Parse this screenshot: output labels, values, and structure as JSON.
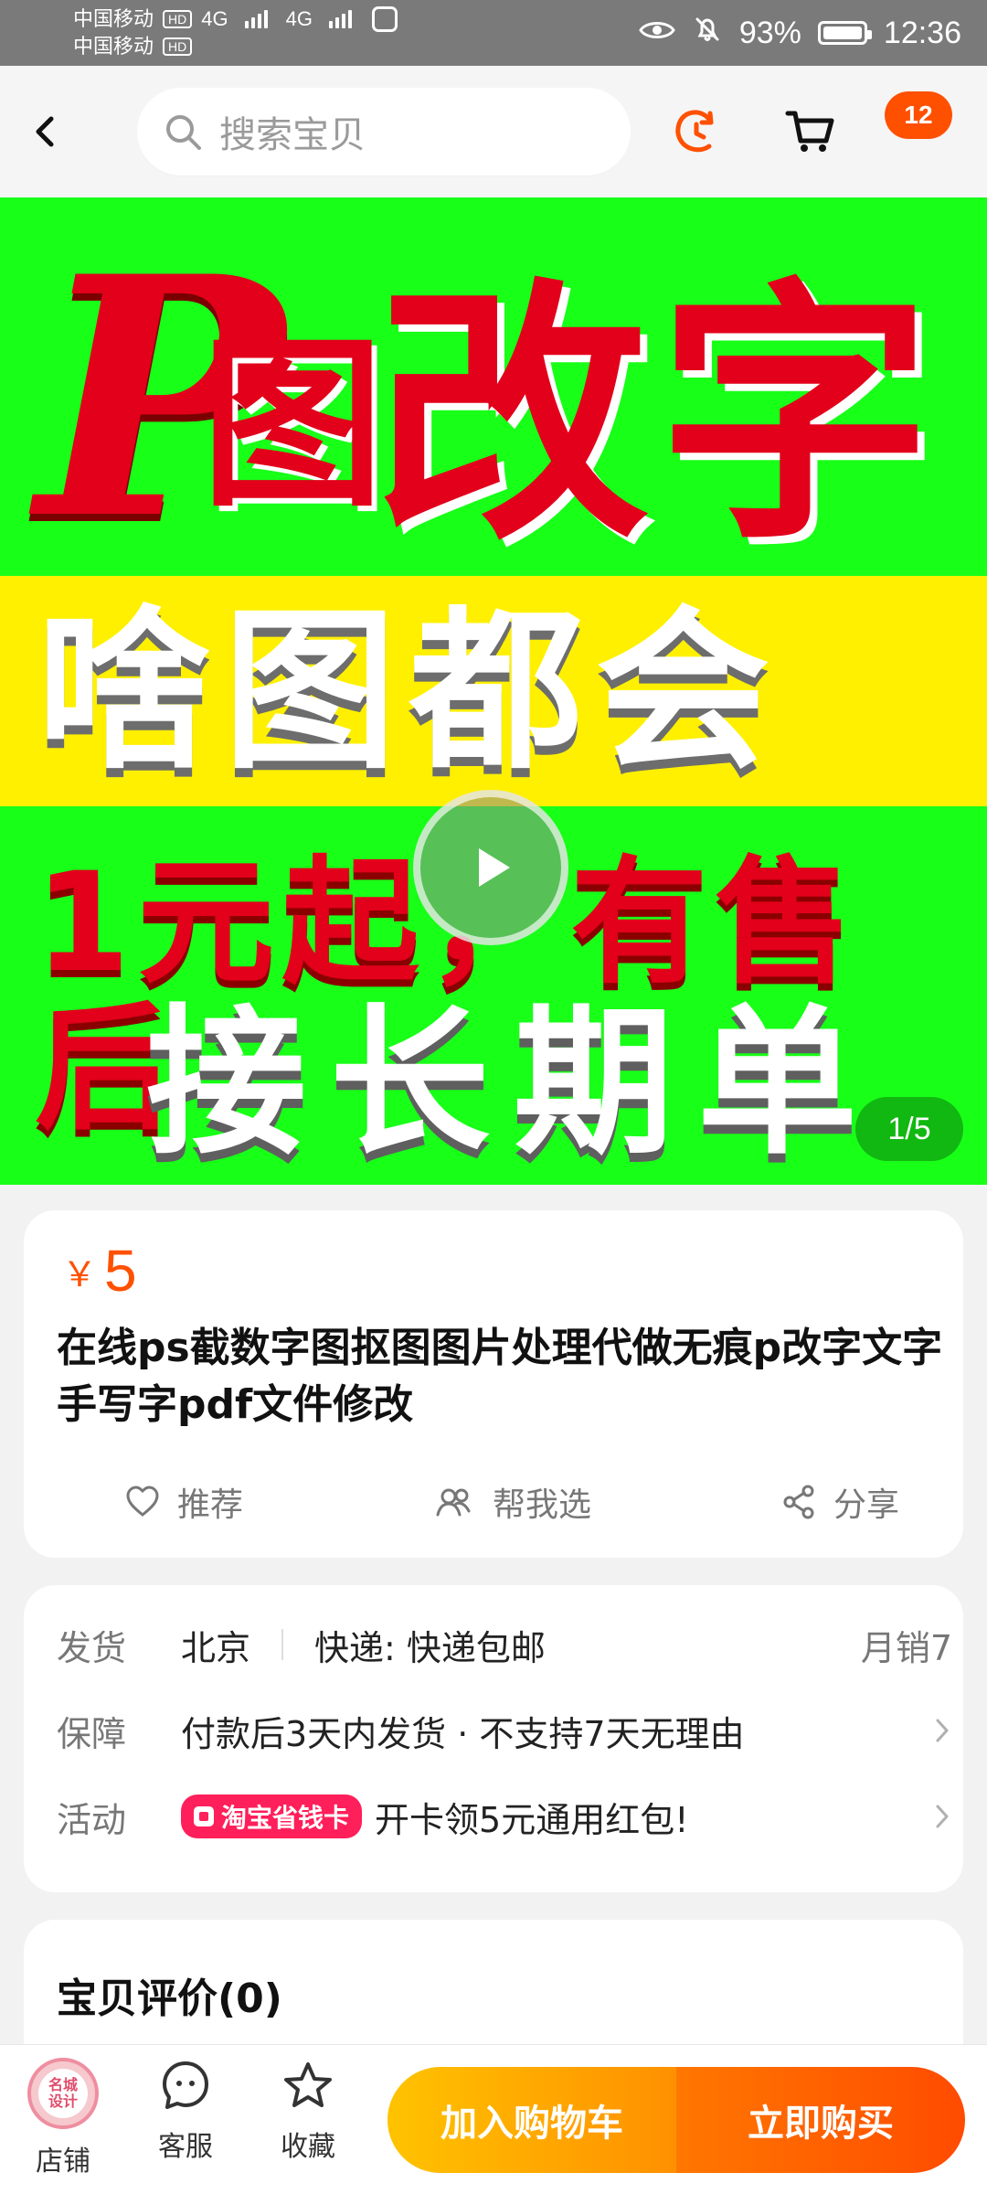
{
  "status_bar": {
    "carrier1": "中国移动",
    "carrier2": "中国移动",
    "hd": "HD",
    "net": "4G",
    "battery_percent": "93%",
    "battery_level": 0.93,
    "time": "12:36"
  },
  "top_nav": {
    "search_placeholder": "搜索宝贝",
    "cart_badge": "12"
  },
  "hero": {
    "p_letter": "P",
    "line1_small": "图",
    "line1_big": "改字",
    "line2": "啥图都会",
    "line3": "1元起，有售后",
    "line4": "接长期单",
    "page_indicator": "1/5"
  },
  "product": {
    "currency": "￥",
    "price": "5",
    "title": "在线ps截数字图抠图图片处理代做无痕p改字文字手写字pdf文件修改",
    "actions": [
      {
        "label": "推荐",
        "icon": "heart-icon"
      },
      {
        "label": "帮我选",
        "icon": "people-icon"
      },
      {
        "label": "分享",
        "icon": "share-icon"
      }
    ]
  },
  "info": {
    "shipping_label": "发货",
    "shipping_from": "北京",
    "delivery": "快递: 快递包邮",
    "monthly_sales": "月销7",
    "guarantee_label": "保障",
    "guarantee_text": "付款后3天内发货 · 不支持7天无理由",
    "promo_label": "活动",
    "promo_tag": "淘宝省钱卡",
    "promo_text": "开卡领5元通用红包!"
  },
  "reviews": {
    "title": "宝贝评价(0)"
  },
  "bottom_bar": {
    "shop_label": "店铺",
    "shop_logo_text": "名城\n设计",
    "service_label": "客服",
    "favorite_label": "收藏",
    "add_to_cart": "加入购物车",
    "buy_now": "立即购买"
  },
  "colors": {
    "accent": "#ff5000",
    "hero_green": "#18ff18",
    "hero_yellow": "#fff000",
    "hero_red": "#e2001b"
  }
}
